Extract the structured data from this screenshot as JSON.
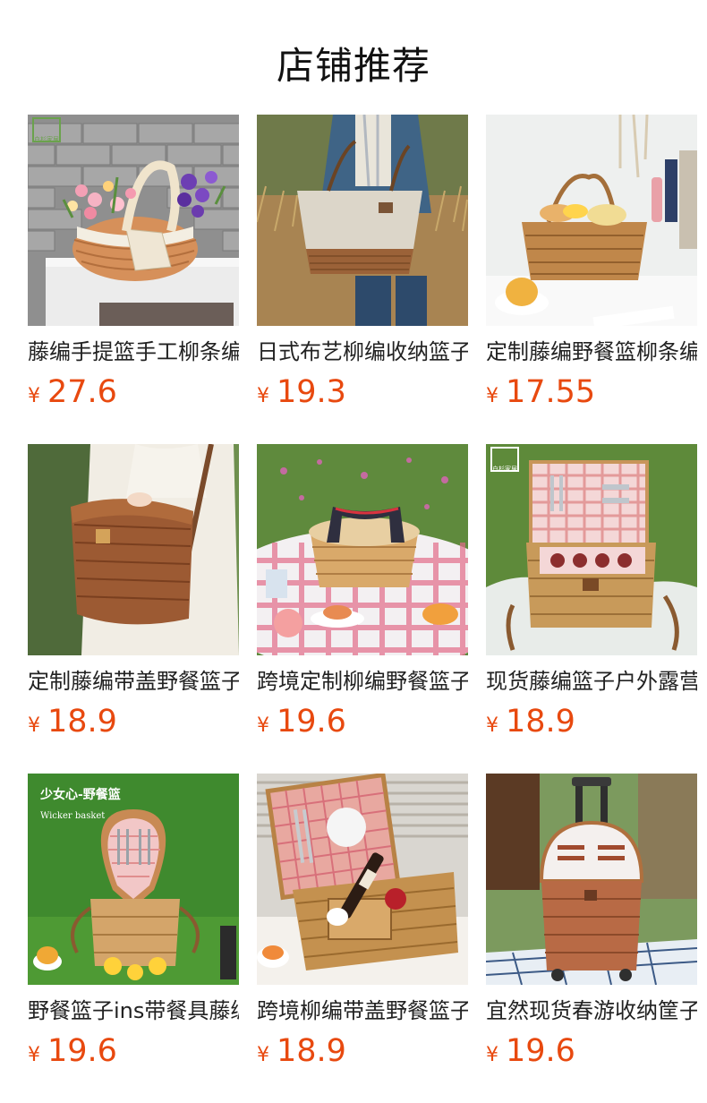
{
  "section": {
    "title": "店铺推荐"
  },
  "currency": "¥",
  "products": [
    {
      "name": "藤编手提篮手工柳条编织",
      "price": "27.6",
      "image": "wicker-flower-basket",
      "watermark": "白杉家居"
    },
    {
      "name": "日式布艺柳编收纳篮子",
      "price": "19.3",
      "image": "fabric-wicker-tote"
    },
    {
      "name": "定制藤编野餐篮柳条编织",
      "price": "17.55",
      "image": "bread-basket"
    },
    {
      "name": "定制藤编带盖野餐篮子",
      "price": "18.9",
      "image": "lidded-shoulder-basket"
    },
    {
      "name": "跨境定制柳编野餐篮子",
      "price": "19.6",
      "image": "striped-handle-basket"
    },
    {
      "name": "现货藤编篮子户外露营",
      "price": "18.9",
      "image": "picnic-set-basket",
      "watermark": "白杉家居"
    },
    {
      "name": "野餐篮子ins带餐具藤编",
      "price": "19.6",
      "image": "heart-picnic-basket",
      "overlay_title": "少女心-野餐篮",
      "overlay_subtitle": "Wicker basket"
    },
    {
      "name": "跨境柳编带盖野餐篮子",
      "price": "18.9",
      "image": "wine-picnic-hamper"
    },
    {
      "name": "宜然现货春游收纳筐子",
      "price": "19.6",
      "image": "trolley-picnic-basket"
    }
  ]
}
